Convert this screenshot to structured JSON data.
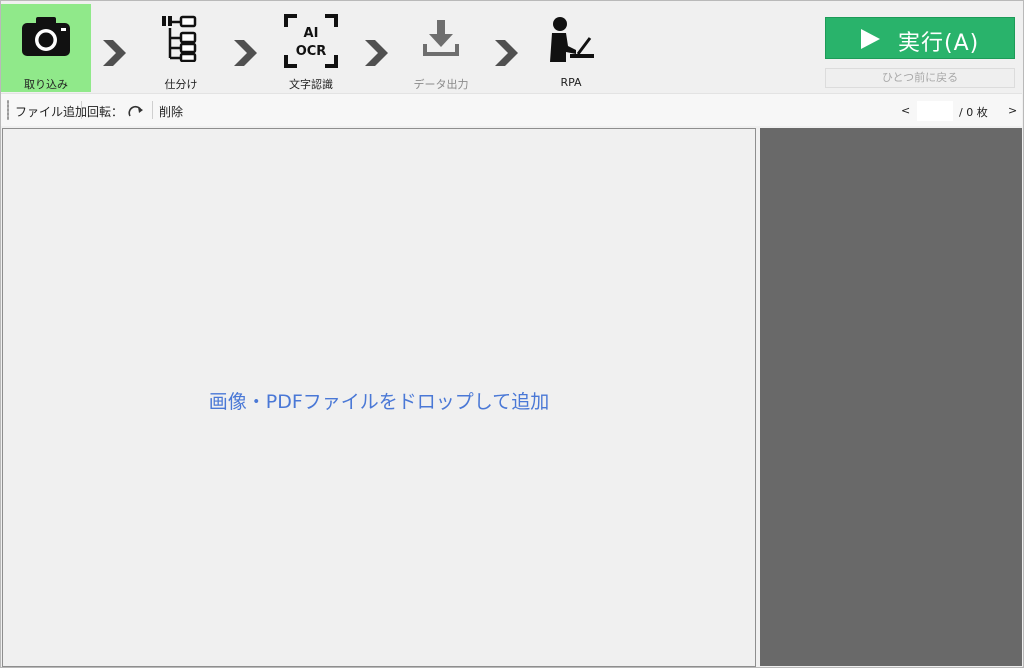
{
  "steps": [
    {
      "label": "取り込み",
      "icon": "camera-icon",
      "active": true
    },
    {
      "label": "仕分け",
      "icon": "tree-sort-icon"
    },
    {
      "label": "文字認識",
      "icon": "ai-ocr-icon",
      "icon_text_top": "AI",
      "icon_text_bottom": "OCR"
    },
    {
      "label": "データ出力",
      "icon": "download-icon",
      "disabled": true
    },
    {
      "label": "RPA",
      "icon": "person-laptop-icon"
    }
  ],
  "actions": {
    "run_label": "実行(A)",
    "back_label": "ひとつ前に戻る"
  },
  "toolbar": {
    "add_file": "ファイル追加",
    "rotate": "回転：",
    "delete": "削除",
    "pager": {
      "prev": "<",
      "next": ">",
      "current": "",
      "total": "/ 0 枚"
    }
  },
  "dropzone": {
    "text": "画像・PDFファイルをドロップして追加"
  },
  "colors": {
    "active_step": "#90e98a",
    "run_button": "#29b36b",
    "drop_text": "#4a78d6",
    "preview_bg": "#696969"
  }
}
